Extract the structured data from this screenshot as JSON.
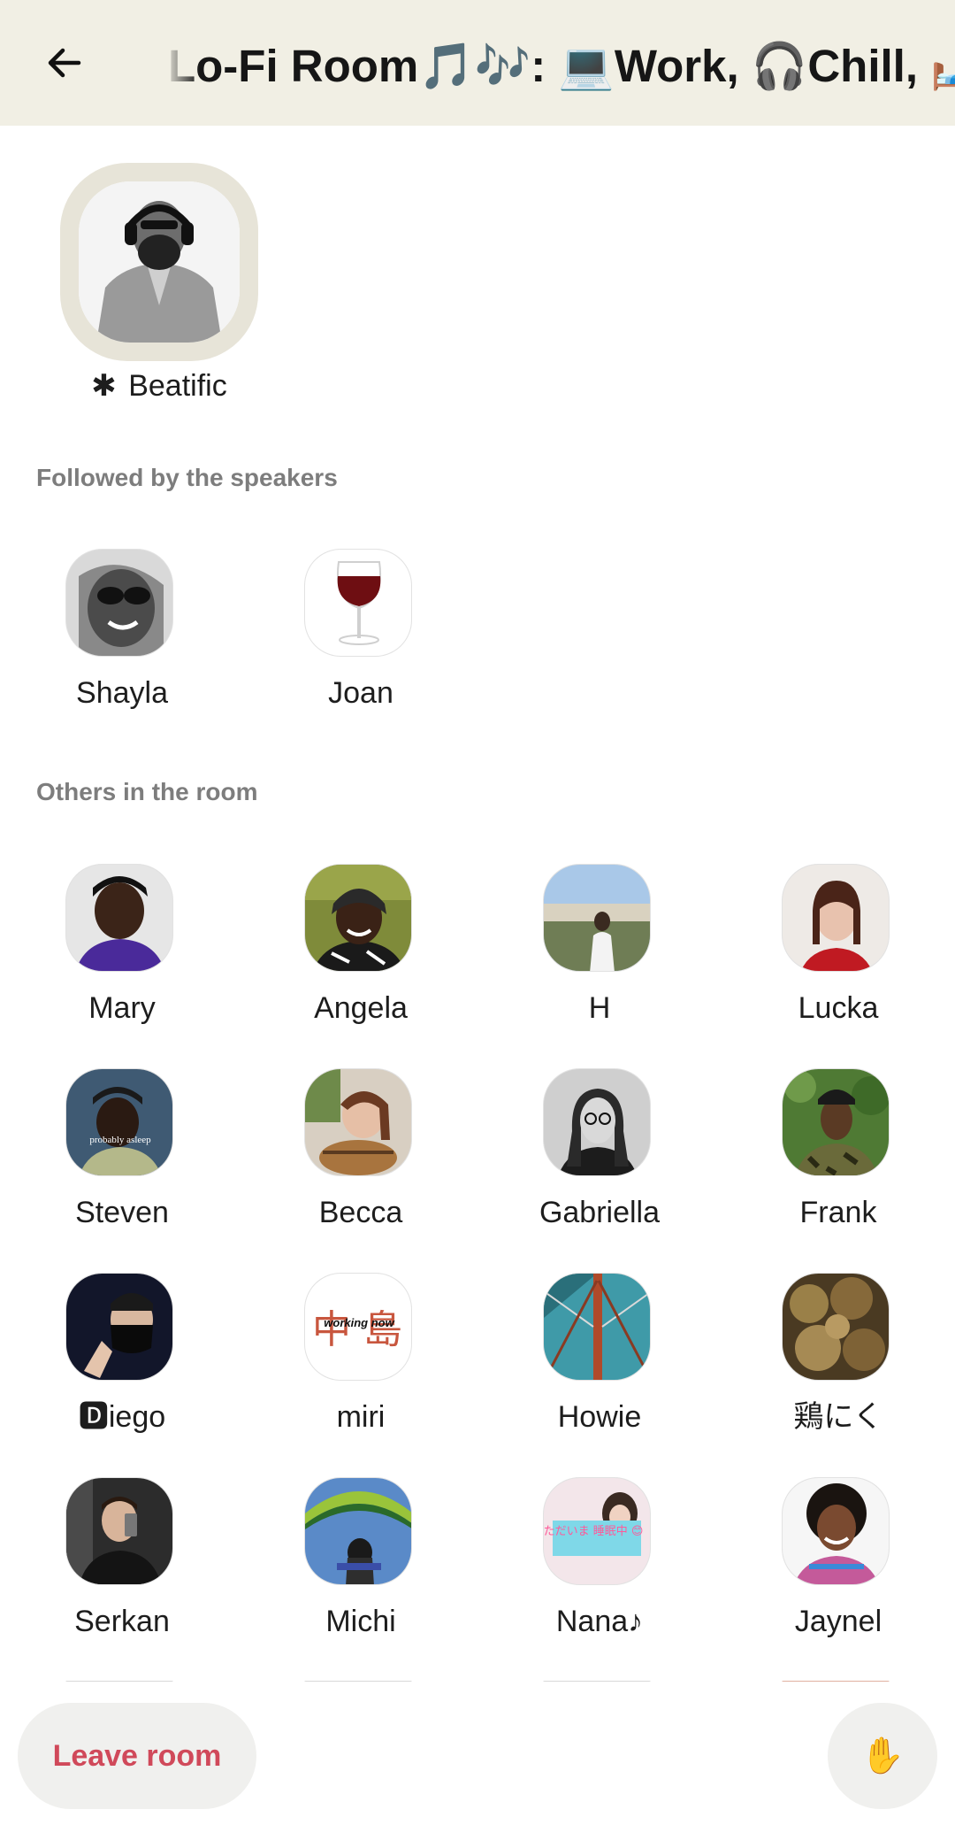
{
  "header": {
    "back_icon": "arrow-left-icon",
    "title": "Lo-Fi Room🎵🎶: 💻Work, 🎧Chill, 🛏️"
  },
  "speaker": {
    "name": "Beatific",
    "moderator_mark": "✱"
  },
  "sections": {
    "followed_label": "Followed by the speakers",
    "others_label": "Others in the room"
  },
  "followed": [
    {
      "name": "Shayla"
    },
    {
      "name": "Joan"
    }
  ],
  "others": [
    {
      "name": "Mary"
    },
    {
      "name": "Angela"
    },
    {
      "name": "H"
    },
    {
      "name": "Lucka"
    },
    {
      "name": "Steven"
    },
    {
      "name": "Becca"
    },
    {
      "name": "Gabriella"
    },
    {
      "name": "Frank"
    },
    {
      "name": "🅳iego"
    },
    {
      "name": "miri"
    },
    {
      "name": "Howie"
    },
    {
      "name": "鶏にく"
    },
    {
      "name": "Serkan"
    },
    {
      "name": "Michi"
    },
    {
      "name": "Nana♪"
    },
    {
      "name": "Jaynel"
    }
  ],
  "avatar_text": {
    "steven": "probably asleep",
    "miri": "working now",
    "nana": "ただいま 睡眠中 😊"
  },
  "bottom": {
    "leave_label": "Leave room",
    "hand_icon": "raised-hand-icon",
    "hand_glyph": "✋"
  },
  "colors": {
    "header_bg": "#f1efe4",
    "leave_text": "#d0495a",
    "section_label": "#7d7d7d"
  }
}
